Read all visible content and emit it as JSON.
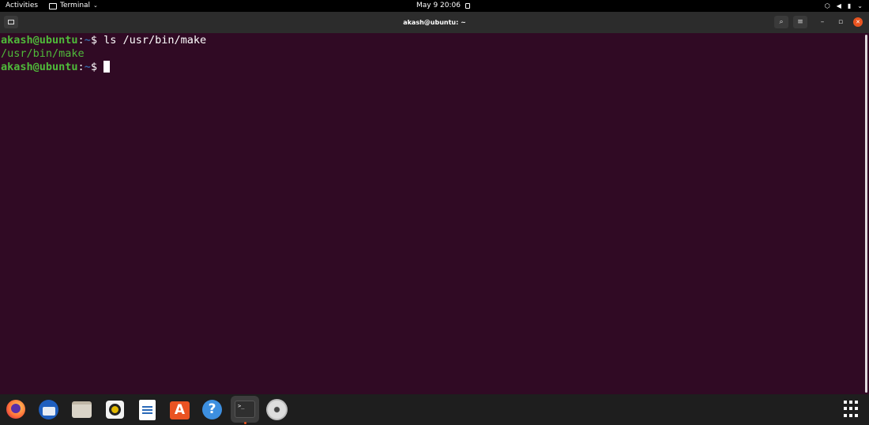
{
  "topbar": {
    "activities": "Activities",
    "app_menu": "Terminal",
    "clock": "May 9  20:06"
  },
  "window": {
    "title": "akash@ubuntu: ~"
  },
  "terminal": {
    "prompt_user": "akash@ubuntu",
    "prompt_colon": ":",
    "prompt_path": "~",
    "prompt_dollar": "$ ",
    "command1": "ls /usr/bin/make",
    "output1": "/usr/bin/make"
  },
  "dock": {
    "items": [
      "firefox-icon",
      "thunderbird-icon",
      "files-icon",
      "rhythmbox-icon",
      "libreoffice-writer-icon",
      "ubuntu-software-icon",
      "help-icon",
      "terminal-icon",
      "dvd-icon"
    ],
    "terminal_prompt_glyph": ">_"
  },
  "colors": {
    "terminal_bg": "#300a24",
    "prompt_green": "#4fba3a",
    "path_blue": "#3465a4",
    "ubuntu_orange": "#e95420"
  }
}
